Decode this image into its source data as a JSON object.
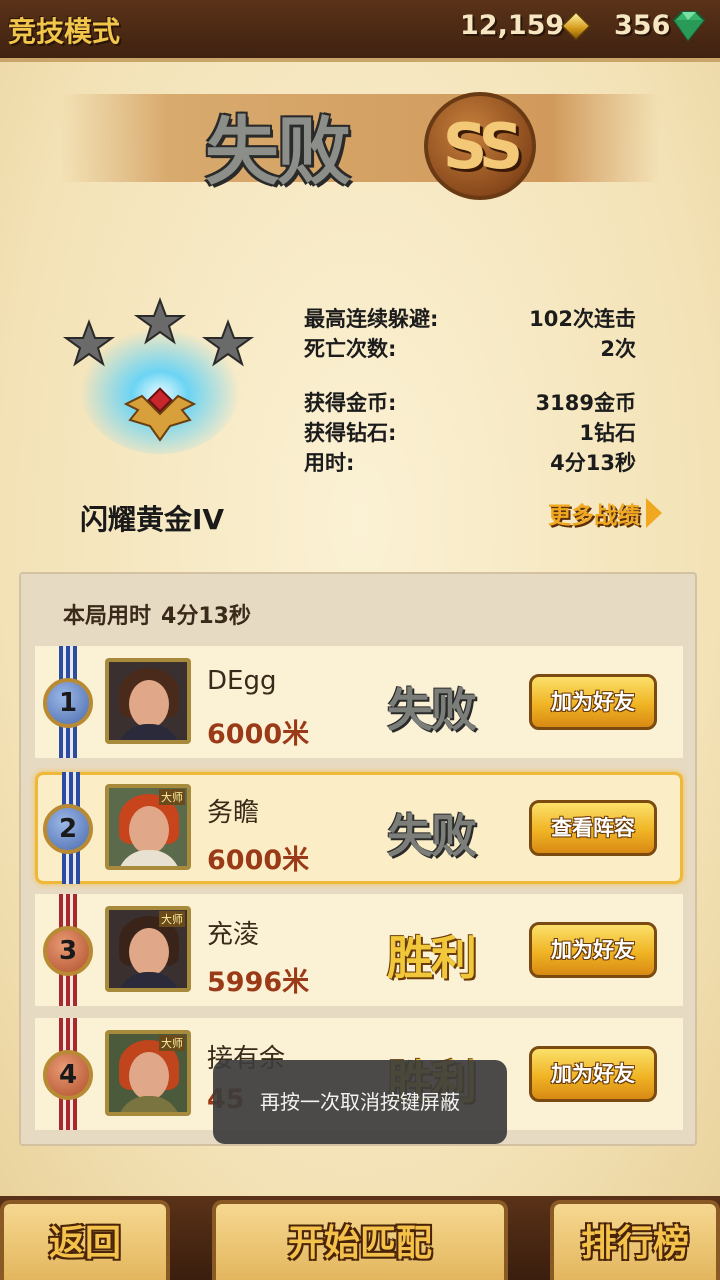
{
  "header": {
    "mode_title": "竞技模式",
    "coins": "12,159",
    "gems": "356"
  },
  "result": {
    "title": "失败",
    "grade": "SS",
    "stars_total": 3,
    "stars_earned": 0,
    "rank_name": "闪耀黄金IV"
  },
  "stats": [
    {
      "label": "最高连续躲避:",
      "value": "102次连击"
    },
    {
      "label": "死亡次数:",
      "value": "2次"
    },
    {
      "label": "获得金币:",
      "value": "3189金币"
    },
    {
      "label": "获得钻石:",
      "value": "1钻石"
    },
    {
      "label": "用时:",
      "value": "4分13秒"
    }
  ],
  "more_stats_label": "更多战绩",
  "panel": {
    "time_label": "本局用时",
    "time_value": "4分13秒",
    "players": [
      {
        "rank": "1",
        "name": "DEgg",
        "distance": "6000米",
        "result": "失败",
        "action": "加为好友",
        "is_self": false,
        "master": false
      },
      {
        "rank": "2",
        "name": "务瞻",
        "distance": "6000米",
        "result": "失败",
        "action": "查看阵容",
        "is_self": true,
        "master": true
      },
      {
        "rank": "3",
        "name": "充淩",
        "distance": "5996米",
        "result": "胜利",
        "action": "加为好友",
        "is_self": false,
        "master": true
      },
      {
        "rank": "4",
        "name": "接有余",
        "distance": "45",
        "result": "胜利",
        "action": "加为好友",
        "is_self": false,
        "master": true
      }
    ],
    "master_tag": "大师"
  },
  "toast": "再按一次取消按键屏蔽",
  "bottom": {
    "back": "返回",
    "match": "开始匹配",
    "rank": "排行榜"
  },
  "colors": {
    "accent_gold": "#f0b424",
    "lose_gray": "#7c7e7a",
    "win_gold": "#f0c83a",
    "distance_red": "#9a3a18"
  }
}
